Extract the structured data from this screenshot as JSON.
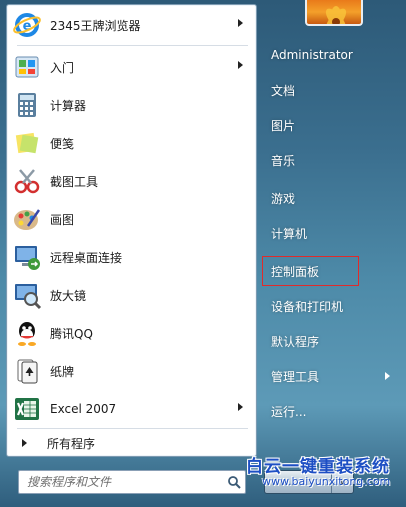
{
  "programs": [
    {
      "label": "2345王牌浏览器",
      "icon": "browser-icon",
      "submenu": true
    },
    {
      "label": "入门",
      "icon": "getting-started-icon",
      "submenu": true
    },
    {
      "label": "计算器",
      "icon": "calculator-icon",
      "submenu": false
    },
    {
      "label": "便笺",
      "icon": "sticky-notes-icon",
      "submenu": false
    },
    {
      "label": "截图工具",
      "icon": "snipping-tool-icon",
      "submenu": false
    },
    {
      "label": "画图",
      "icon": "paint-icon",
      "submenu": false
    },
    {
      "label": "远程桌面连接",
      "icon": "remote-desktop-icon",
      "submenu": false
    },
    {
      "label": "放大镜",
      "icon": "magnifier-icon",
      "submenu": false
    },
    {
      "label": "腾讯QQ",
      "icon": "qq-icon",
      "submenu": false
    },
    {
      "label": "纸牌",
      "icon": "solitaire-icon",
      "submenu": false
    },
    {
      "label": "Excel 2007",
      "icon": "excel-icon",
      "submenu": true
    }
  ],
  "all_programs_label": "所有程序",
  "search": {
    "placeholder": "搜索程序和文件"
  },
  "right_menu": [
    {
      "label": "Administrator",
      "submenu": false,
      "highlighted": false
    },
    {
      "label": "文档",
      "submenu": false,
      "highlighted": false
    },
    {
      "label": "图片",
      "submenu": false,
      "highlighted": false
    },
    {
      "label": "音乐",
      "submenu": false,
      "highlighted": false
    },
    {
      "label": "游戏",
      "submenu": false,
      "highlighted": false
    },
    {
      "label": "计算机",
      "submenu": false,
      "highlighted": false
    },
    {
      "label": "控制面板",
      "submenu": false,
      "highlighted": true
    },
    {
      "label": "设备和打印机",
      "submenu": false,
      "highlighted": false
    },
    {
      "label": "默认程序",
      "submenu": false,
      "highlighted": false
    },
    {
      "label": "管理工具",
      "submenu": true,
      "highlighted": false
    },
    {
      "label": "运行...",
      "submenu": false,
      "highlighted": false
    }
  ],
  "watermark": {
    "title": "白云一键重装系统",
    "url": "www.baiyunxitong.com"
  },
  "colors": {
    "highlight_border": "#e02b2b",
    "watermark_blue": "#1d4fc4"
  }
}
